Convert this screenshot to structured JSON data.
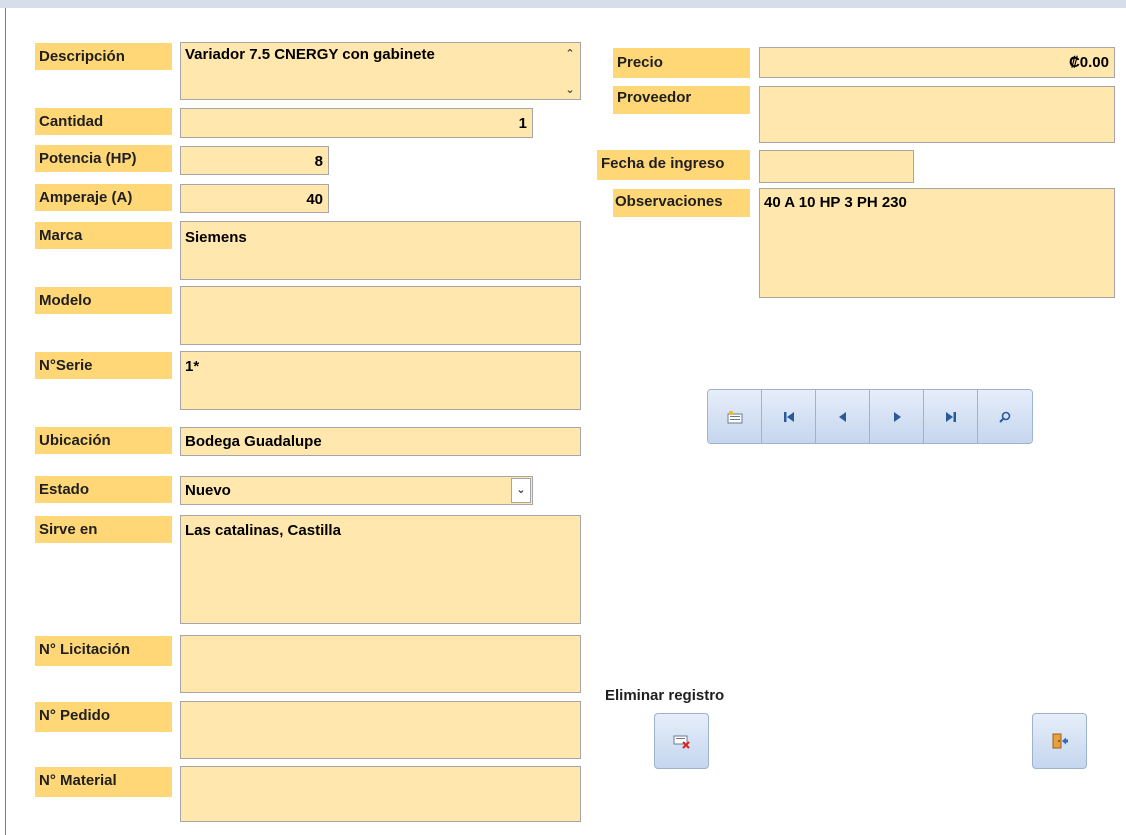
{
  "labels": {
    "descripcion": "Descripción",
    "cantidad": "Cantidad",
    "potencia": "Potencia (HP)",
    "amperaje": "Amperaje (A)",
    "marca": "Marca",
    "modelo": "Modelo",
    "serie": "N°Serie",
    "ubicacion": "Ubicación",
    "estado": "Estado",
    "sirve_en": "Sirve en",
    "licitacion": "N° Licitación",
    "pedido": "N° Pedido",
    "material": "N° Material",
    "precio": "Precio",
    "proveedor": "Proveedor",
    "fecha_ingreso": "Fecha de ingreso",
    "observaciones": "Observaciones"
  },
  "values": {
    "descripcion": "Variador 7.5 CNERGY con gabinete",
    "cantidad": "1",
    "potencia": "8",
    "amperaje": "40",
    "marca": "Siemens",
    "modelo": "",
    "serie": "1*",
    "ubicacion": "Bodega Guadalupe",
    "estado": "Nuevo",
    "sirve_en": "Las catalinas, Castilla",
    "licitacion": "",
    "pedido": "",
    "material": "",
    "precio": "₡0.00",
    "proveedor": "",
    "fecha_ingreso": "",
    "observaciones": "40 A 10 HP 3 PH 230"
  },
  "nav_icons": [
    "new-record-icon",
    "first-record-icon",
    "previous-record-icon",
    "next-record-icon",
    "last-record-icon",
    "find-icon"
  ],
  "actions": {
    "delete_caption": "Eliminar registro",
    "delete_icon": "delete-record-icon",
    "exit_icon": "exit-door-icon"
  },
  "colors": {
    "label_bg": "#ffd777",
    "field_bg": "#ffe7ad",
    "button_blue": "#c5d6ef"
  }
}
